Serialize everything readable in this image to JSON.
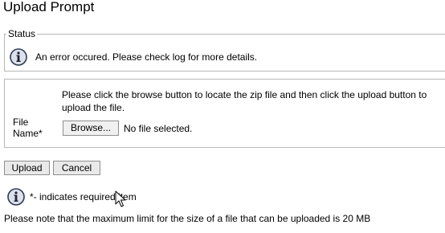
{
  "page": {
    "title": "Upload Prompt"
  },
  "status": {
    "legend": "Status",
    "icon": "info-icon",
    "message": "An error occured. Please check log for more details."
  },
  "form": {
    "instructions": "Please click the browse button to locate the zip file and then click the upload button to upload the file.",
    "file_name_label": "File Name*",
    "browse_label": "Browse...",
    "file_status": "No file selected."
  },
  "actions": {
    "upload_label": "Upload",
    "cancel_label": "Cancel"
  },
  "notes": {
    "required": "*- indicates required item",
    "limit": "Please note that the maximum limit for the size of a file that can be uploaded is 20 MB"
  },
  "colors": {
    "border": "#b8b8b8",
    "button_bg": "#e9e9e9",
    "icon_fill": "#dde1ea",
    "icon_stroke": "#2e3a57"
  }
}
